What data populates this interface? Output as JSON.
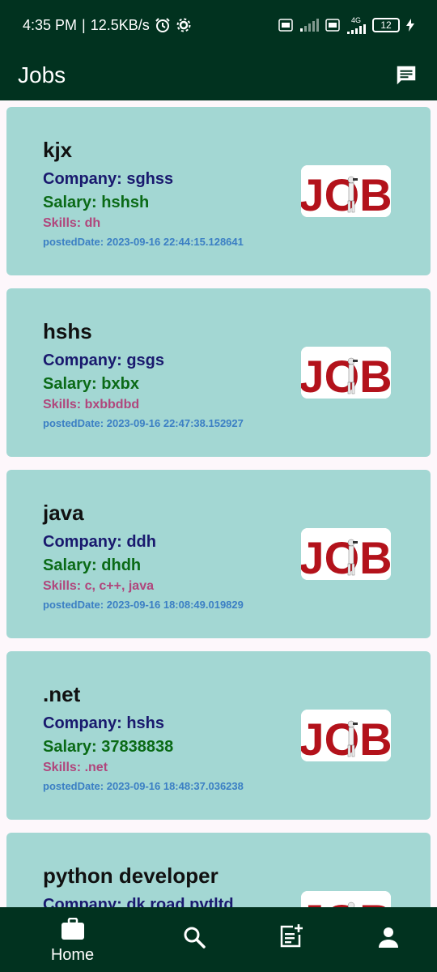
{
  "status_bar": {
    "time": "4:35 PM",
    "speed": "12.5KB/s",
    "battery": "12",
    "net_label": "4G"
  },
  "appbar": {
    "title": "Jobs",
    "action_icon": "chat-icon"
  },
  "jobs": [
    {
      "title": "kjx",
      "company": "Company: sghss",
      "salary": "Salary: hshsh",
      "skills": "Skills: dh",
      "posted": "postedDate: 2023-09-16 22:44:15.128641"
    },
    {
      "title": "hshs",
      "company": "Company: gsgs",
      "salary": "Salary: bxbx",
      "skills": "Skills: bxbbdbd",
      "posted": "postedDate: 2023-09-16 22:47:38.152927"
    },
    {
      "title": "java",
      "company": "Company: ddh",
      "salary": "Salary: dhdh",
      "skills": "Skills: c, c++, java",
      "posted": "postedDate: 2023-09-16 18:08:49.019829"
    },
    {
      "title": ".net",
      "company": "Company: hshs",
      "salary": "Salary: 37838838",
      "skills": "Skills: .net",
      "posted": "postedDate: 2023-09-16 18:48:37.036238"
    },
    {
      "title": "python developer",
      "company": "Company: dk road pvtltd",
      "salary": "",
      "skills": "",
      "posted": ""
    }
  ],
  "job_image_text": "JOB",
  "bottom_nav": {
    "home_label": "Home",
    "items": [
      "briefcase-icon",
      "search-icon",
      "post-add-icon",
      "person-icon"
    ]
  },
  "colors": {
    "bar": "#01321f",
    "card": "#a3d7d3",
    "company": "#19196e",
    "salary": "#0a6a16",
    "skills": "#b0467c",
    "posted": "#3b7fc4"
  }
}
